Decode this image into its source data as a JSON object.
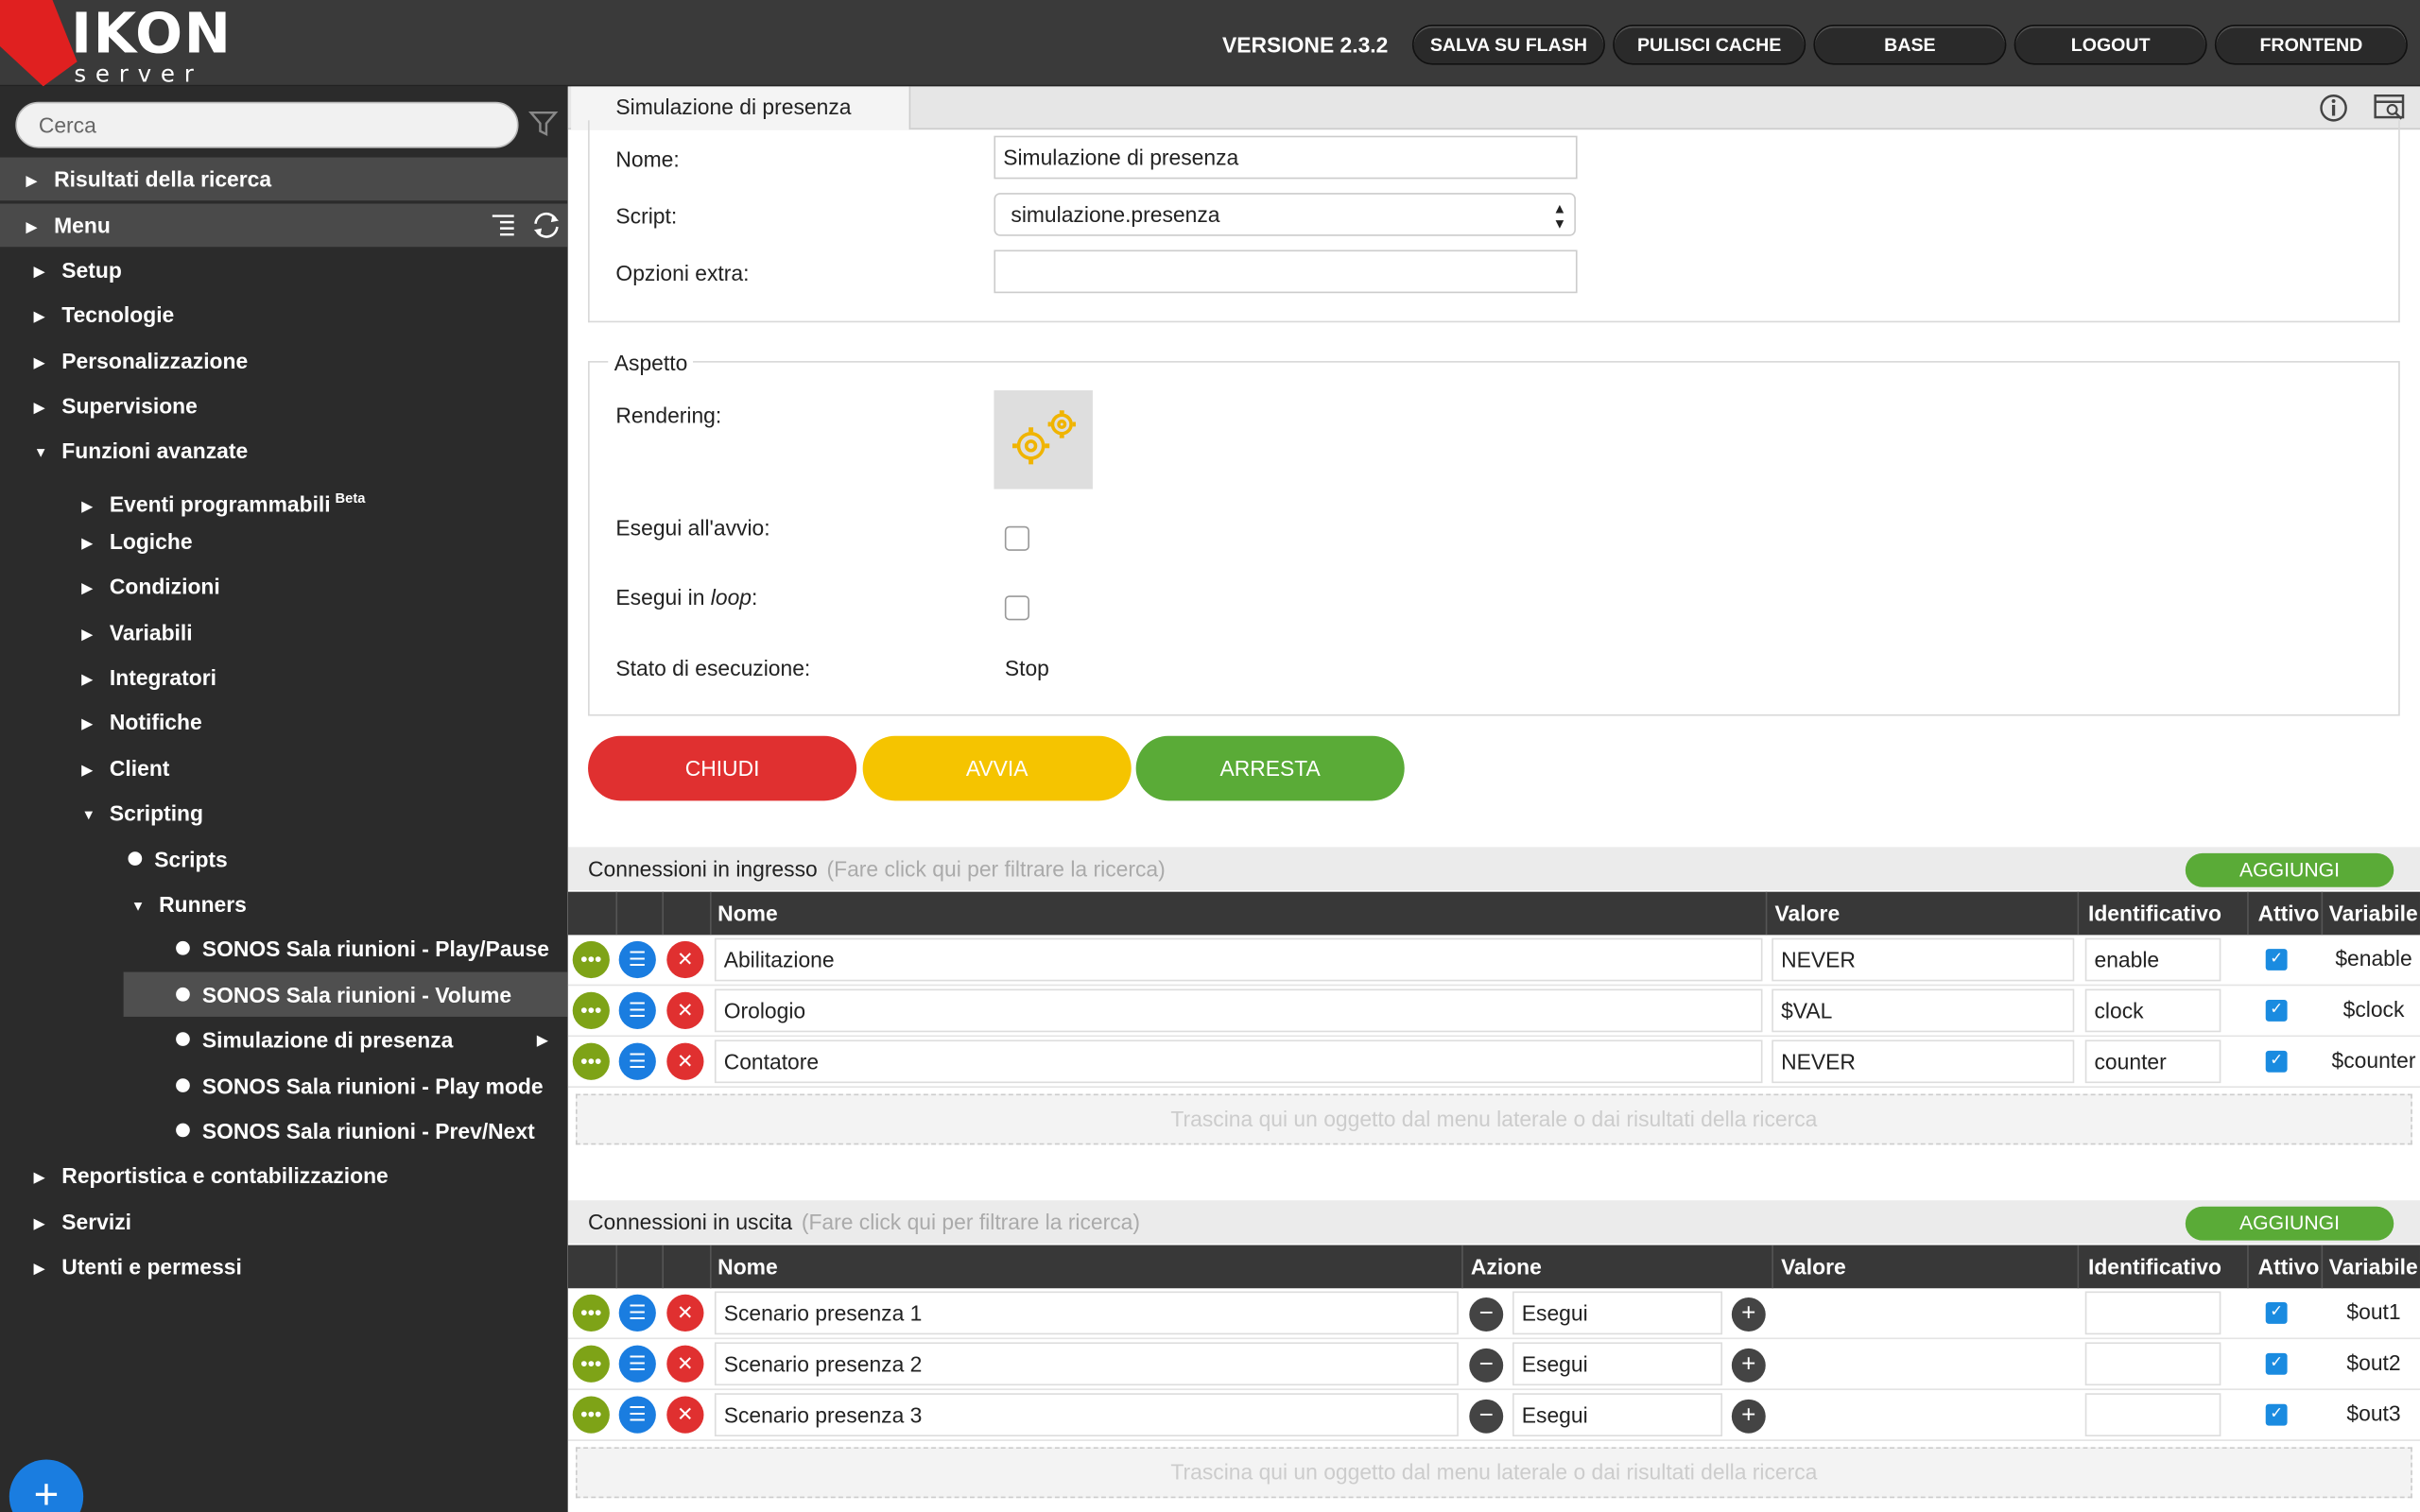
{
  "header": {
    "logo_text": "IKON",
    "logo_sub": "server",
    "version": "VERSIONE 2.3.2",
    "buttons": [
      "SALVA SU FLASH",
      "PULISCI CACHE",
      "BASE",
      "LOGOUT",
      "FRONTEND"
    ]
  },
  "sidebar": {
    "search_placeholder": "Cerca",
    "results": "Risultati della ricerca",
    "menu": "Menu",
    "items": [
      "Setup",
      "Tecnologie",
      "Personalizzazione",
      "Supervisione",
      "Funzioni avanzate"
    ],
    "advanced": [
      "Eventi programmabili",
      "Logiche",
      "Condizioni",
      "Variabili",
      "Integratori",
      "Notifiche",
      "Client",
      "Scripting"
    ],
    "beta": "Beta",
    "scripting": [
      "Scripts",
      "Runners"
    ],
    "runners": [
      "SONOS Sala riunioni - Play/Pause",
      "SONOS Sala riunioni - Volume",
      "Simulazione di presenza",
      "SONOS Sala riunioni - Play mode",
      "SONOS Sala riunioni - Prev/Next"
    ],
    "bottom": [
      "Reportistica e contabilizzazione",
      "Servizi",
      "Utenti e permessi"
    ],
    "fab": "+"
  },
  "main": {
    "tab": "Simulazione di presenza",
    "form": {
      "name_label": "Nome:",
      "name_value": "Simulazione di presenza",
      "script_label": "Script:",
      "script_value": "simulazione.presenza",
      "extra_label": "Opzioni extra:",
      "extra_value": ""
    },
    "aspect": {
      "legend": "Aspetto",
      "rendering": "Rendering:",
      "autostart": "Esegui all'avvio:",
      "loop_pre": "Esegui in ",
      "loop_em": "loop",
      "loop_post": ":",
      "state_label": "Stato di esecuzione:",
      "state_value": "Stop"
    },
    "actions": {
      "close": "CHIUDI",
      "start": "AVVIA",
      "stop": "ARRESTA"
    },
    "inputs": {
      "title": "Connessioni in ingresso",
      "hint": "(Fare click qui per filtrare la ricerca)",
      "add": "AGGIUNGI",
      "cols": [
        "Nome",
        "Valore",
        "Identificativo",
        "Attivo",
        "Variabile"
      ],
      "rows": [
        {
          "name": "Abilitazione",
          "value": "NEVER",
          "id": "enable",
          "var": "$enable"
        },
        {
          "name": "Orologio",
          "value": "$VAL",
          "id": "clock",
          "var": "$clock"
        },
        {
          "name": "Contatore",
          "value": "NEVER",
          "id": "counter",
          "var": "$counter"
        }
      ],
      "drop": "Trascina qui un oggetto dal menu laterale o dai risultati della ricerca"
    },
    "outputs": {
      "title": "Connessioni in uscita",
      "hint": "(Fare click qui per filtrare la ricerca)",
      "add": "AGGIUNGI",
      "cols": [
        "Nome",
        "Azione",
        "Valore",
        "Identificativo",
        "Attivo",
        "Variabile"
      ],
      "rows": [
        {
          "name": "Scenario presenza 1",
          "action": "Esegui",
          "var": "$out1"
        },
        {
          "name": "Scenario presenza 2",
          "action": "Esegui",
          "var": "$out2"
        },
        {
          "name": "Scenario presenza 3",
          "action": "Esegui",
          "var": "$out3"
        }
      ],
      "drop": "Trascina qui un oggetto dal menu laterale o dai risultati della ricerca"
    }
  },
  "colors": {
    "red": "#e03030",
    "yellow": "#f5c400",
    "green": "#5aab37",
    "blue": "#1a7de0",
    "olive": "#7ea317"
  }
}
